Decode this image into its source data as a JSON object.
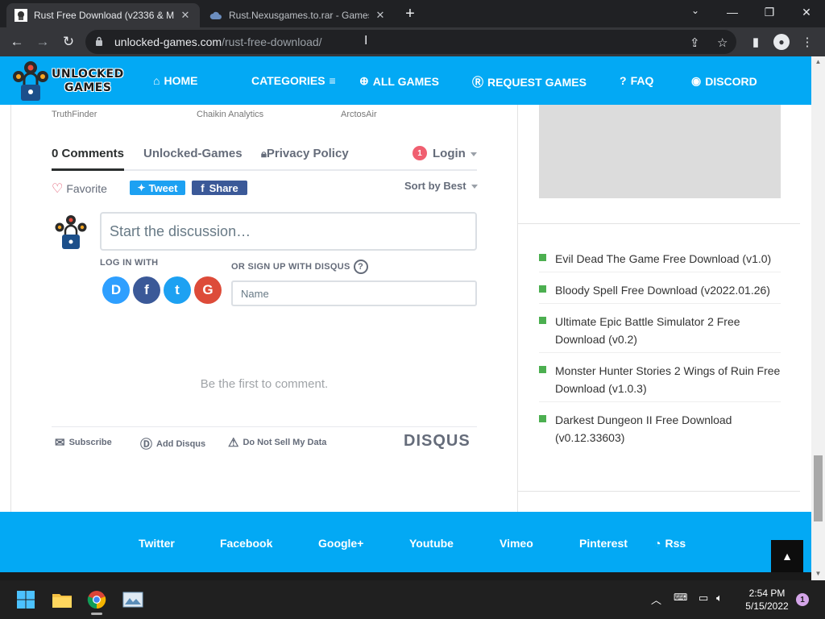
{
  "browser": {
    "tabs": [
      {
        "title": "Rust Free Download (v2336 & M",
        "active": true
      },
      {
        "title": "Rust.Nexusgames.to.rar - Games",
        "active": false
      }
    ],
    "url_host": "unlocked-games.com",
    "url_path": "/rust-free-download/"
  },
  "site": {
    "logo_line1": "UNLOCKED",
    "logo_line2": "GAMES",
    "nav": [
      {
        "icon": "home-icon",
        "label": "HOME"
      },
      {
        "icon": "menu-icon",
        "label": "CATEGORIES"
      },
      {
        "icon": "globe-icon",
        "label": "ALL GAMES"
      },
      {
        "icon": "r-icon",
        "label": "REQUEST GAMES"
      },
      {
        "icon": "question-icon",
        "label": "FAQ"
      },
      {
        "icon": "discord-icon",
        "label": "DISCORD"
      }
    ],
    "accent_color": "#03a9f4"
  },
  "ads": [
    "TruthFinder",
    "Chaikin Analytics",
    "ArctosAir"
  ],
  "disqus": {
    "tabs": {
      "comments": "0 Comments",
      "community": "Unlocked-Games",
      "privacy": "Privacy Policy",
      "login": "Login",
      "login_badge": "1"
    },
    "favorite": "Favorite",
    "tweet": "Tweet",
    "share": "Share",
    "sort": "Sort by Best",
    "discussion_placeholder": "Start the discussion…",
    "login_with": "LOG IN WITH",
    "signup_with": "OR SIGN UP WITH DISQUS",
    "social": [
      {
        "letter": "D",
        "color": "#2e9fff"
      },
      {
        "letter": "f",
        "color": "#3b5998"
      },
      {
        "letter": "t",
        "color": "#1da1f2"
      },
      {
        "letter": "G",
        "color": "#dd4b39"
      }
    ],
    "name_placeholder": "Name",
    "first_comment": "Be the first to comment.",
    "footer": {
      "subscribe": "Subscribe",
      "add_disqus": "Add Disqus",
      "do_not_sell": "Do Not Sell My Data",
      "brand": "DISQUS"
    }
  },
  "sidebar": {
    "items": [
      "Evil Dead The Game Free Download (v1.0)",
      "Bloody Spell Free Download (v2022.01.26)",
      "Ultimate Epic Battle Simulator 2 Free Download (v0.2)",
      "Monster Hunter Stories 2 Wings of Ruin Free Download (v1.0.3)",
      "Darkest Dungeon II Free Download (v0.12.33603)"
    ]
  },
  "footer": {
    "links": [
      "Twitter",
      "Facebook",
      "Google+",
      "Youtube",
      "Vimeo",
      "Pinterest",
      "Rss"
    ]
  },
  "taskbar": {
    "time": "2:54 PM",
    "date": "5/15/2022",
    "notifications": "1"
  }
}
